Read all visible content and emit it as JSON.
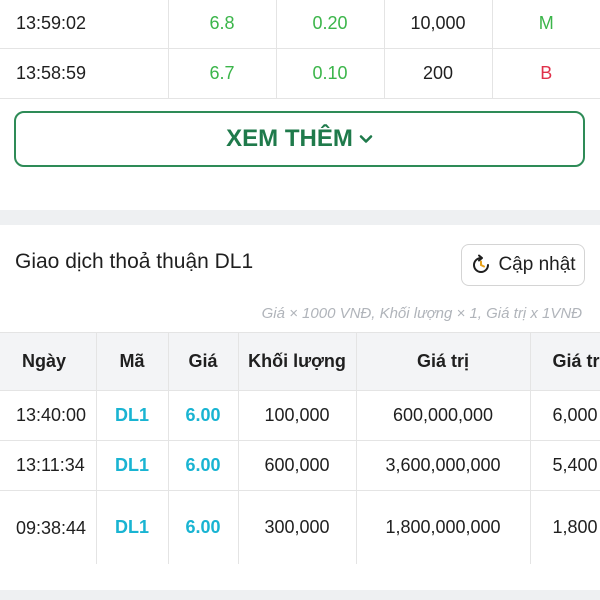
{
  "matched_rows": [
    {
      "time": "13:59:02",
      "price": "6.8",
      "change": "0.20",
      "volume": "10,000",
      "side": "M",
      "side_color": "green"
    },
    {
      "time": "13:58:59",
      "price": "6.7",
      "change": "0.10",
      "volume": "200",
      "side": "B",
      "side_color": "red"
    }
  ],
  "more_button": {
    "label": "XEM THÊM"
  },
  "deal_section": {
    "title": "Giao dịch thoả thuận DL1",
    "refresh_label": "Cập nhật",
    "note": "Giá × 1000 VNĐ, Khối lượng × 1, Giá trị x 1VNĐ",
    "columns": [
      "Ngày",
      "Mã",
      "Giá",
      "Khối lượng",
      "Giá trị",
      "Giá trị"
    ],
    "rows": [
      {
        "date": "13:40:00",
        "code": "DL1",
        "price": "6.00",
        "volume": "100,000",
        "value": "600,000,000",
        "value2": "6,000"
      },
      {
        "date": "13:11:34",
        "code": "DL1",
        "price": "6.00",
        "volume": "600,000",
        "value": "3,600,000,000",
        "value2": "5,400"
      },
      {
        "date": "09:38:44",
        "code": "DL1",
        "price": "6.00",
        "volume": "300,000",
        "value": "1,800,000,000",
        "value2": "1,800"
      }
    ]
  },
  "colors": {
    "accent_green": "#1f7a4b",
    "price_green": "#3bb54a",
    "sell_red": "#e0304a",
    "code_cyan": "#19b4d2"
  }
}
